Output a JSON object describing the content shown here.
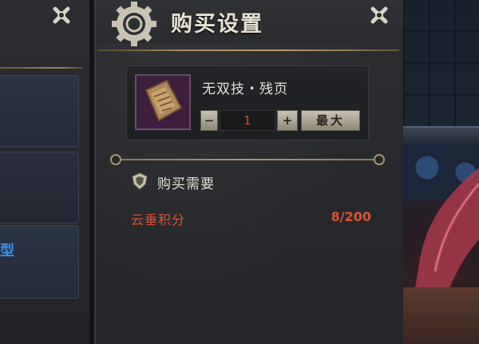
{
  "window": {
    "title": "购买设置"
  },
  "left_panel": {
    "partial_tab_label": "型"
  },
  "item": {
    "name": "无双技・残页",
    "quantity": "1",
    "minus_label": "−",
    "plus_label": "+",
    "max_label": "最大"
  },
  "requirements": {
    "heading": "购买需要",
    "currency_name": "云垂积分",
    "currency_value": "8/200"
  },
  "colors": {
    "cost_red": "#e0512f",
    "gold_accent": "#a89468",
    "quantity_red": "#e0442e"
  },
  "icons": {
    "title": "gear-icon",
    "close": "close-icon",
    "requirement": "shield-icon",
    "item": "scroll-page-icon"
  }
}
